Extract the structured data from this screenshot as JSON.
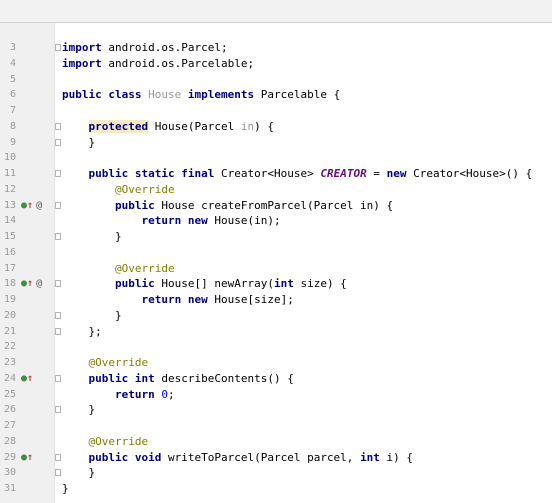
{
  "editor": {
    "lines": [
      {
        "n": "3",
        "text": "import android.os.Parcel;"
      },
      {
        "n": "4",
        "text": "import android.os.Parcelable;"
      },
      {
        "n": "5",
        "text": ""
      },
      {
        "n": "6",
        "text": "public class House implements Parcelable {"
      },
      {
        "n": "7",
        "text": ""
      },
      {
        "n": "8",
        "text": "    protected House(Parcel in) {"
      },
      {
        "n": "9",
        "text": "    }"
      },
      {
        "n": "10",
        "text": ""
      },
      {
        "n": "11",
        "text": "    public static final Creator<House> CREATOR = new Creator<House>() {"
      },
      {
        "n": "12",
        "text": "        @Override"
      },
      {
        "n": "13",
        "text": "        public House createFromParcel(Parcel in) {"
      },
      {
        "n": "14",
        "text": "            return new House(in);"
      },
      {
        "n": "15",
        "text": "        }"
      },
      {
        "n": "16",
        "text": ""
      },
      {
        "n": "17",
        "text": "        @Override"
      },
      {
        "n": "18",
        "text": "        public House[] newArray(int size) {"
      },
      {
        "n": "19",
        "text": "            return new House[size];"
      },
      {
        "n": "20",
        "text": "        }"
      },
      {
        "n": "21",
        "text": "    };"
      },
      {
        "n": "22",
        "text": ""
      },
      {
        "n": "23",
        "text": "    @Override"
      },
      {
        "n": "24",
        "text": "    public int describeContents() {"
      },
      {
        "n": "25",
        "text": "        return 0;"
      },
      {
        "n": "26",
        "text": "    }"
      },
      {
        "n": "27",
        "text": ""
      },
      {
        "n": "28",
        "text": "    @Override"
      },
      {
        "n": "29",
        "text": "    public void writeToParcel(Parcel parcel, int i) {"
      },
      {
        "n": "30",
        "text": "    }"
      },
      {
        "n": "31",
        "text": "}"
      }
    ],
    "gutter_icons": {
      "13": {
        "implement": "implements-method-icon",
        "override": "@"
      },
      "18": {
        "implement": "implements-method-icon",
        "override": "@"
      },
      "24": {
        "implement": "implements-method-icon"
      },
      "29": {
        "implement": "implements-method-icon"
      }
    },
    "fold_markers": [
      "3",
      "8",
      "9",
      "11",
      "13",
      "15",
      "18",
      "20",
      "21",
      "24",
      "26",
      "29",
      "30"
    ],
    "colors": {
      "keyword": "#000080",
      "annotation": "#808000",
      "constant": "#660e7a",
      "number": "#0000ff",
      "unused_identifier": "#999999",
      "line_number": "#999999",
      "highlight": "#f6eac2"
    }
  }
}
